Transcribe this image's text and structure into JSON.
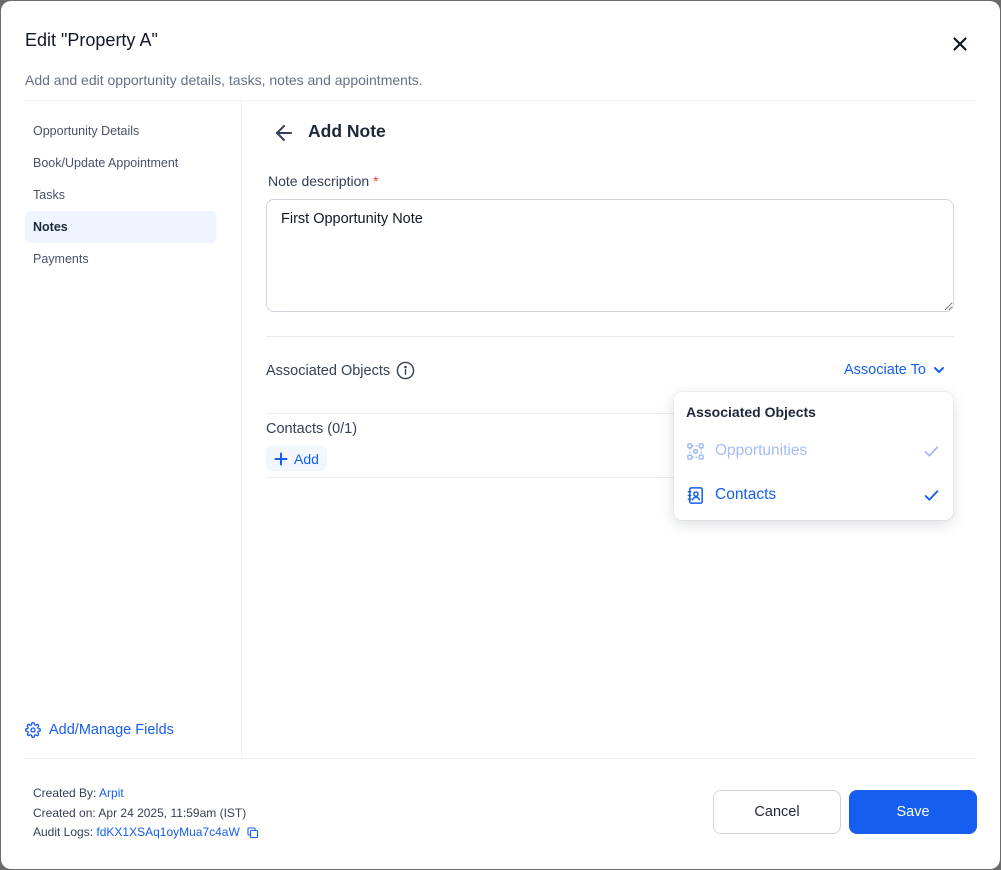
{
  "modal": {
    "title": "Edit \"Property A\"",
    "subtitle": "Add and edit opportunity details, tasks, notes and appointments."
  },
  "sidebar": {
    "items": [
      {
        "label": "Opportunity Details",
        "active": false
      },
      {
        "label": "Book/Update Appointment",
        "active": false
      },
      {
        "label": "Tasks",
        "active": false
      },
      {
        "label": "Notes",
        "active": true
      },
      {
        "label": "Payments",
        "active": false
      }
    ],
    "manage_label": "Add/Manage Fields"
  },
  "note": {
    "page_title": "Add Note",
    "description_label": "Note description",
    "required_mark": "*",
    "description_value": "First Opportunity Note"
  },
  "associations": {
    "title": "Associated Objects",
    "associate_to_label": "Associate To",
    "contacts_label": "Contacts (0/1)",
    "add_label": "Add"
  },
  "dropdown": {
    "title": "Associated Objects",
    "items": [
      {
        "label": "Opportunities",
        "icon": "opportunities-icon",
        "checked": true,
        "disabled": true
      },
      {
        "label": "Contacts",
        "icon": "contacts-icon",
        "checked": true,
        "disabled": false
      }
    ]
  },
  "footer": {
    "created_by_label": "Created By:",
    "created_by_value": "Arpit",
    "created_on_label": "Created on:",
    "created_on_value": "Apr 24 2025, 11:59am (IST)",
    "audit_logs_label": "Audit Logs:",
    "audit_logs_value": "fdKX1XSAq1oyMua7c4aW",
    "cancel_label": "Cancel",
    "save_label": "Save"
  },
  "colors": {
    "accent": "#155eef",
    "accent_light": "#a4bcf5",
    "active_bg": "#eff4ff",
    "required": "#f04438"
  }
}
